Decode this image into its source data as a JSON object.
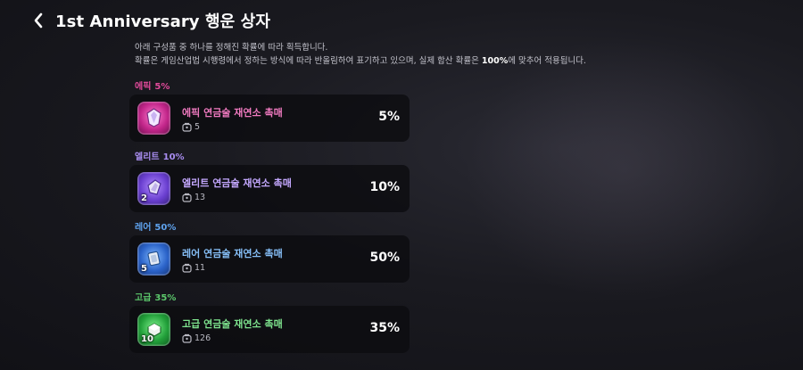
{
  "header": {
    "title": "1st Anniversary 행운 상자"
  },
  "description": {
    "line1": "아래 구성품 중 하나를 정해진 확률에 따라 획득합니다.",
    "line2_prefix": "확률은 게임산업법 시행령에서 정하는 방식에 따라 반올림하여 표기하고 있으며, 실제 합산 확률은 ",
    "line2_bold": "100%",
    "line2_suffix": "에 맞추어 적용됩니다."
  },
  "grades": [
    {
      "label": "에픽",
      "percent": "5%",
      "color": "#e24a9b",
      "item": {
        "name": "에픽 연금술 재연소 촉매",
        "count": "",
        "owned": "5",
        "rate": "5%"
      }
    },
    {
      "label": "엘리트",
      "percent": "10%",
      "color": "#a98df0",
      "item": {
        "name": "엘리트 연금술 재연소 촉매",
        "count": "2",
        "owned": "13",
        "rate": "10%"
      }
    },
    {
      "label": "레어",
      "percent": "50%",
      "color": "#5fa3ef",
      "item": {
        "name": "레어 연금술 재연소 촉매",
        "count": "5",
        "owned": "11",
        "rate": "50%"
      }
    },
    {
      "label": "고급",
      "percent": "35%",
      "color": "#5cc96c",
      "item": {
        "name": "고급 연금술 재연소 촉매",
        "count": "10",
        "owned": "126",
        "rate": "35%"
      }
    }
  ],
  "icons": {
    "back": "chevron-left-icon",
    "owned": "inventory-bag-icon",
    "item": "catalyst-crystal-icon"
  }
}
